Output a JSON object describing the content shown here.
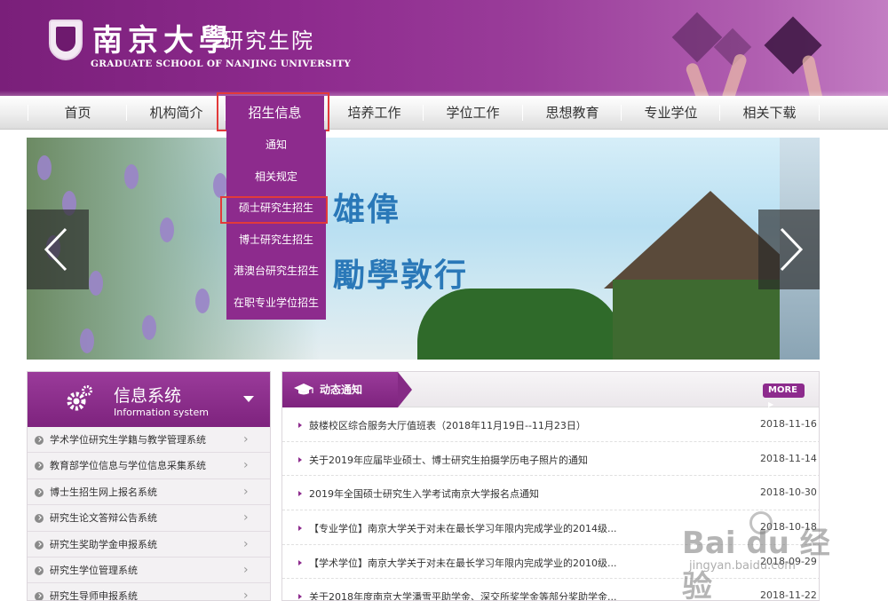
{
  "header": {
    "logo_cn": "南京大學",
    "dept_cn": "研究生院",
    "logo_en": "GRADUATE SCHOOL OF NANJING UNIVERSITY"
  },
  "nav": {
    "items": [
      {
        "label": "首页"
      },
      {
        "label": "机构简介"
      },
      {
        "label": "招生信息",
        "active": true
      },
      {
        "label": "培养工作"
      },
      {
        "label": "学位工作"
      },
      {
        "label": "思想教育"
      },
      {
        "label": "专业学位"
      },
      {
        "label": "相关下载"
      }
    ]
  },
  "dropdown": {
    "items": [
      {
        "label": "通知"
      },
      {
        "label": "相关规定"
      },
      {
        "label": "硕士研究生招生",
        "highlighted": true
      },
      {
        "label": "博士研究生招生"
      },
      {
        "label": "港澳台研究生招生"
      },
      {
        "label": "在职专业学位招生"
      }
    ]
  },
  "banner": {
    "slogan_line1": "雄偉",
    "slogan_line2": "勵學敦行"
  },
  "sidebar": {
    "title": "信息系统",
    "subtitle": "Information system",
    "items": [
      {
        "label": "学术学位研究生学籍与教学管理系统"
      },
      {
        "label": "教育部学位信息与学位信息采集系统"
      },
      {
        "label": "博士生招生网上报名系统"
      },
      {
        "label": "研究生论文答辩公告系统"
      },
      {
        "label": "研究生奖助学金申报系统"
      },
      {
        "label": "研究生学位管理系统"
      },
      {
        "label": "研究生导师申报系统"
      }
    ]
  },
  "news": {
    "title": "动态通知",
    "more_label": "MORE",
    "items": [
      {
        "text": "鼓楼校区综合服务大厅值班表（2018年11月19日--11月23日）",
        "date": "2018-11-16"
      },
      {
        "text": "关于2019年应届毕业硕士、博士研究生拍摄学历电子照片的通知",
        "date": "2018-11-14"
      },
      {
        "text": "2019年全国硕士研究生入学考试南京大学报名点通知",
        "date": "2018-10-30"
      },
      {
        "text": "【专业学位】南京大学关于对未在最长学习年限内完成学业的2014级...",
        "date": "2018-10-18"
      },
      {
        "text": "【学术学位】南京大学关于对未在最长学习年限内完成学业的2010级...",
        "date": "2018-09-29"
      },
      {
        "text": "关于2018年度南京大学潘雪平助学金、深交所奖学金等部分奖助学金...",
        "date": "2018-11-22"
      }
    ]
  },
  "watermark": {
    "brand": "Bai du 经验",
    "url": "jingyan.baidu.com"
  },
  "colors": {
    "brand_purple": "#8d2b8d",
    "highlight_red": "#e23a3a"
  }
}
